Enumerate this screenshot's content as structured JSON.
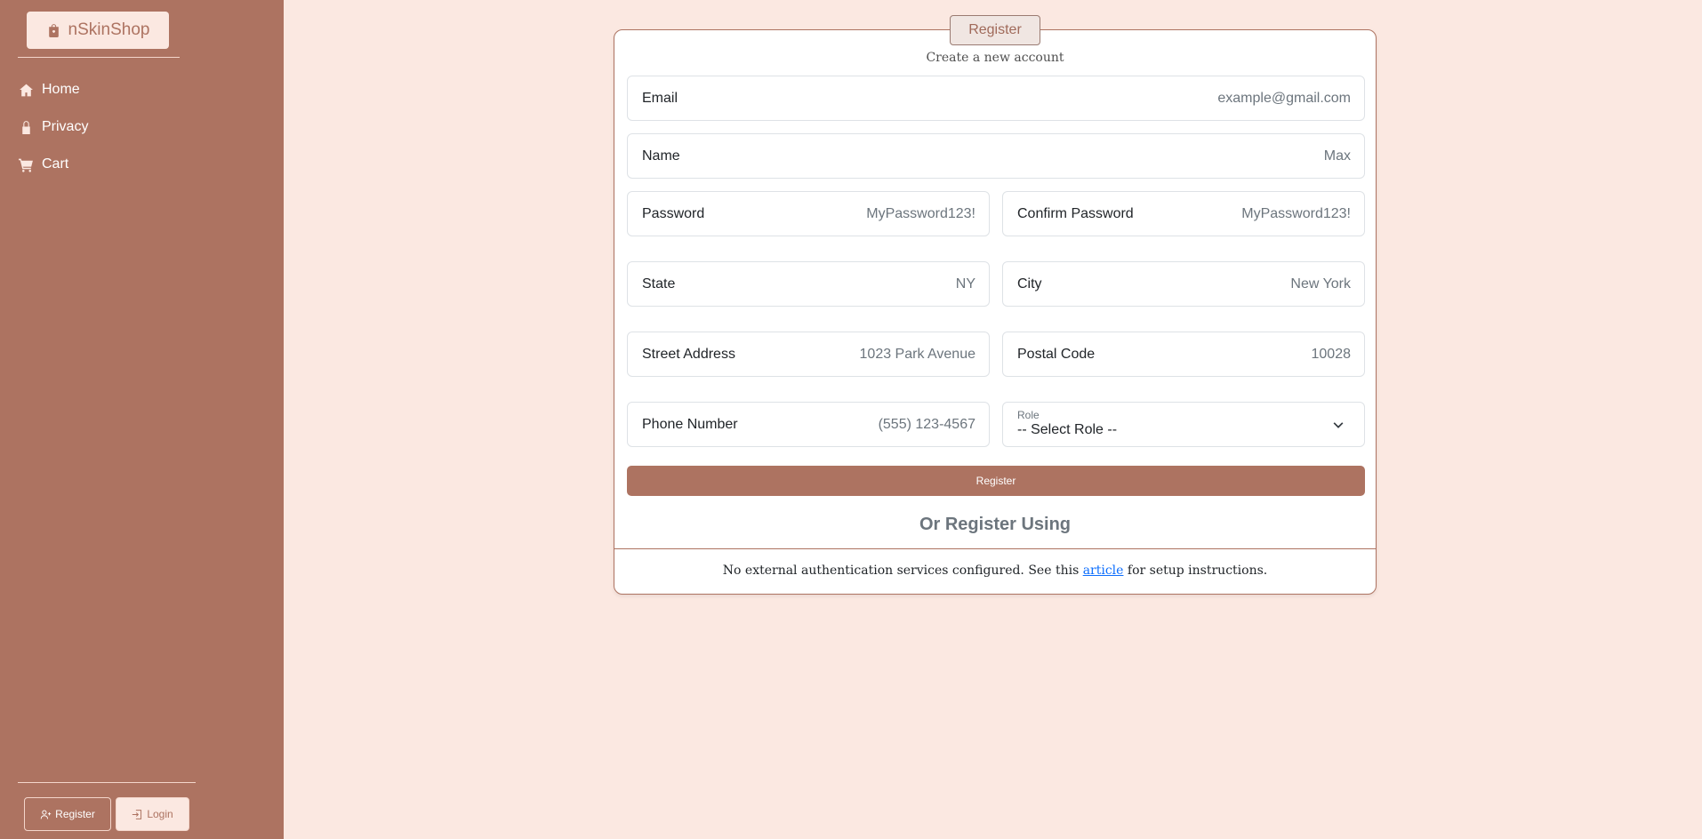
{
  "brand": {
    "name": "nSkinShop",
    "icon": "shopping-bag-icon"
  },
  "nav": {
    "items": [
      {
        "label": "Home",
        "icon": "house-icon"
      },
      {
        "label": "Privacy",
        "icon": "lock-icon"
      },
      {
        "label": "Cart",
        "icon": "cart-icon"
      }
    ]
  },
  "account": {
    "register_label": "Register",
    "login_label": "Login"
  },
  "card": {
    "tab_label": "Register",
    "subtitle": "Create a new account",
    "fields": {
      "email": {
        "label": "Email",
        "placeholder": "example@gmail.com"
      },
      "name": {
        "label": "Name",
        "placeholder": "Max"
      },
      "password": {
        "label": "Password",
        "placeholder": "MyPassword123!"
      },
      "confirm_password": {
        "label": "Confirm Password",
        "placeholder": "MyPassword123!"
      },
      "state": {
        "label": "State",
        "placeholder": "NY"
      },
      "city": {
        "label": "City",
        "placeholder": "New York"
      },
      "street": {
        "label": "Street Address",
        "placeholder": "1023 Park Avenue"
      },
      "postal": {
        "label": "Postal Code",
        "placeholder": "10028"
      },
      "phone": {
        "label": "Phone Number",
        "placeholder": "(555) 123-4567"
      },
      "role": {
        "label": "Role",
        "selected": "-- Select Role --"
      }
    },
    "submit_label": "Register",
    "or_heading": "Or Register Using",
    "external": {
      "text_before": "No external authentication services configured. See this ",
      "link_text": "article",
      "text_after": " for setup instructions."
    }
  },
  "colors": {
    "accent": "#ad7361",
    "background": "#fbe8e1",
    "link": "#0d6efd"
  }
}
